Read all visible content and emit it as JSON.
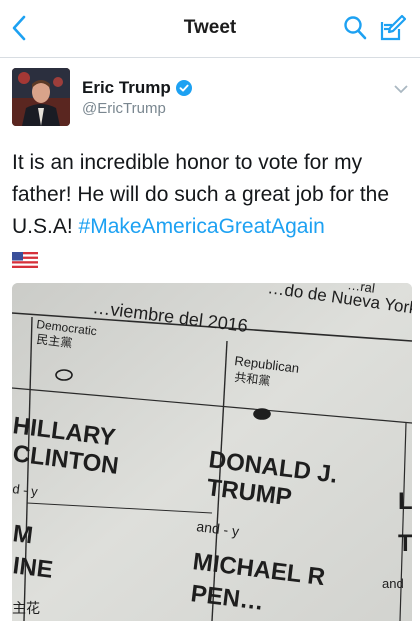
{
  "header": {
    "title": "Tweet"
  },
  "tweet": {
    "author_name": "Eric Trump",
    "author_handle": "@EricTrump",
    "text_main": "It is an incredible honor to vote for my father! He will do such a great job for the U.S.A! ",
    "hashtag": "#MakeAmericaGreatAgain",
    "emoji": "US-flag"
  },
  "ballot": {
    "header_line1": "…viembre del 2016",
    "header_line2": "…do de Nueva York",
    "header_frag": "…ral",
    "party_dem": "Democratic",
    "party_dem_cn": "民主黨",
    "party_rep": "Republican",
    "party_rep_cn": "共和黨",
    "clinton_1": "HILLARY",
    "clinton_2": "CLINTON",
    "clinton_and": "d - y",
    "kaine_1": "M",
    "kaine_2": "INE",
    "trump_1": "DONALD J.",
    "trump_2": "TRUMP",
    "trump_and": "and - y",
    "pence_1": "MICHAEL R",
    "pence_2": "PEN…",
    "right_1": "L",
    "right_2": "T",
    "right_and": "and",
    "cn_frag": "主花"
  },
  "colors": {
    "link": "#1da1f2",
    "verified": "#1da1f2",
    "muted": "#7a8790",
    "ballot_paper": "#dadbd7",
    "ballot_ink": "#1e1e1e"
  },
  "icons": [
    "back-chevron-icon",
    "search-icon",
    "compose-icon",
    "verified-badge-icon",
    "caret-down-icon",
    "us-flag-icon"
  ]
}
